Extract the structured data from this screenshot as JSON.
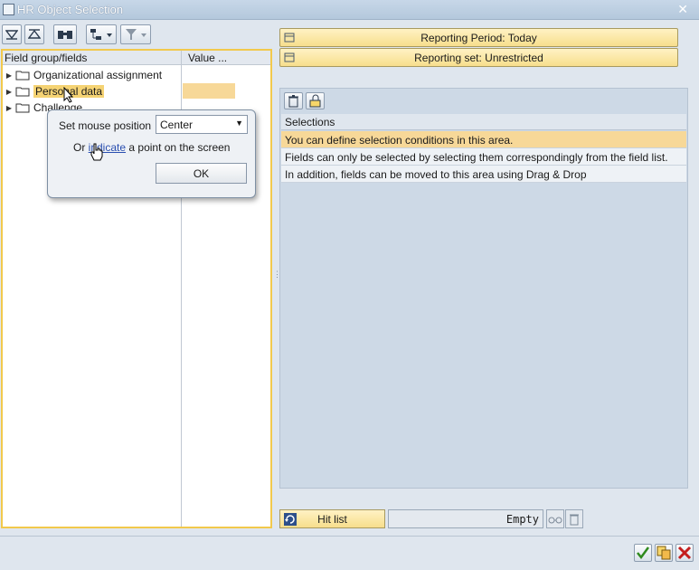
{
  "window": {
    "title": "HR Object Selection"
  },
  "tree": {
    "columns": [
      "Field group/fields",
      "Value ..."
    ],
    "items": [
      {
        "label": "Organizational assignment"
      },
      {
        "label": "Personal data"
      },
      {
        "label": "Challenge"
      }
    ]
  },
  "popup": {
    "set_mouse_label": "Set mouse position",
    "position_value": "Center",
    "or_text": "Or ",
    "indicate_link": "indicate",
    "rest_text": " a point on the screen",
    "ok_label": "OK"
  },
  "reporting": {
    "period_label": "Reporting Period: Today",
    "set_label": "Reporting set: Unrestricted"
  },
  "selections": {
    "header": "Selections",
    "rows": [
      "You can define selection conditions in this area.",
      "Fields can only be selected by selecting them correspondingly from the field list.",
      "In addition, fields can be moved to this area using Drag & Drop"
    ]
  },
  "hitlist": {
    "button_label": "Hit list",
    "status": "Empty"
  },
  "colors": {
    "accent_yellow": "#f7d898",
    "panel_blue": "#cdd9e6",
    "highlight_border": "#f2c94c"
  }
}
